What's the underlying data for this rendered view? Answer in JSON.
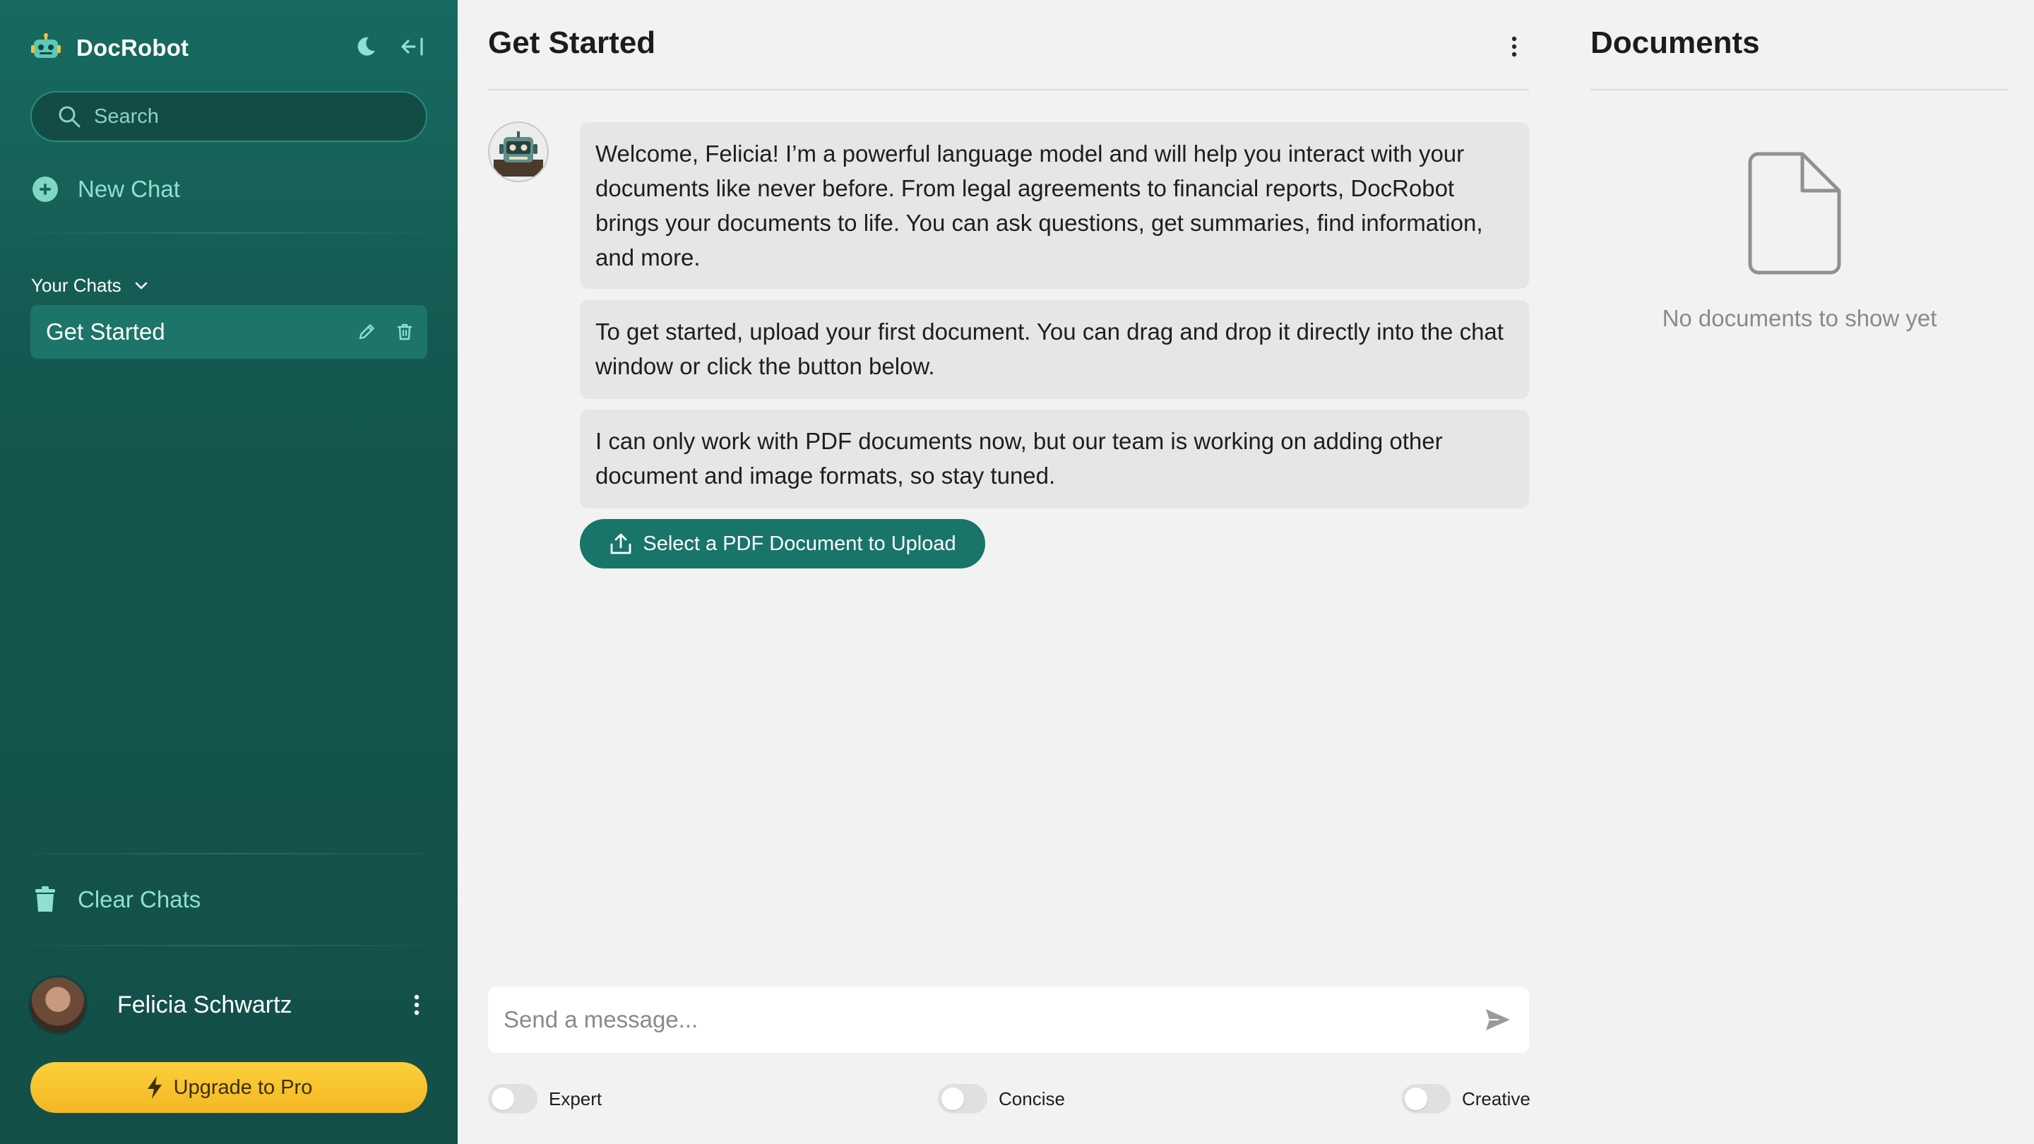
{
  "app": {
    "name": "DocRobot"
  },
  "sidebar": {
    "search_placeholder": "Search",
    "new_chat_label": "New Chat",
    "your_chats_label": "Your Chats",
    "chats": [
      {
        "title": "Get Started",
        "active": true
      }
    ],
    "clear_chats_label": "Clear Chats",
    "user": {
      "name": "Felicia Schwartz"
    },
    "upgrade_label": "Upgrade to Pro"
  },
  "main": {
    "title": "Get Started",
    "messages": [
      "Welcome, Felicia! I’m a powerful language model and will help you interact with your documents like never before. From legal agreements to financial reports, DocRobot brings your documents to life. You can ask questions, get summaries, find information, and more.",
      "To get started, upload your first document. You can drag and drop it directly into the chat window or click the button below.",
      "I can only work with PDF documents now, but our team is working on adding other document and image formats, so stay tuned."
    ],
    "upload_button_label": "Select a PDF Document to Upload",
    "composer_placeholder": "Send a message...",
    "toggles": [
      {
        "label": "Expert",
        "on": false
      },
      {
        "label": "Concise",
        "on": false
      },
      {
        "label": "Creative",
        "on": false
      }
    ]
  },
  "documents": {
    "title": "Documents",
    "empty_text": "No documents to show yet"
  },
  "colors": {
    "sidebar_bg": "#176a60",
    "accent": "#187568",
    "accent_light": "#8fe0cf",
    "upgrade": "#f9c22e"
  }
}
